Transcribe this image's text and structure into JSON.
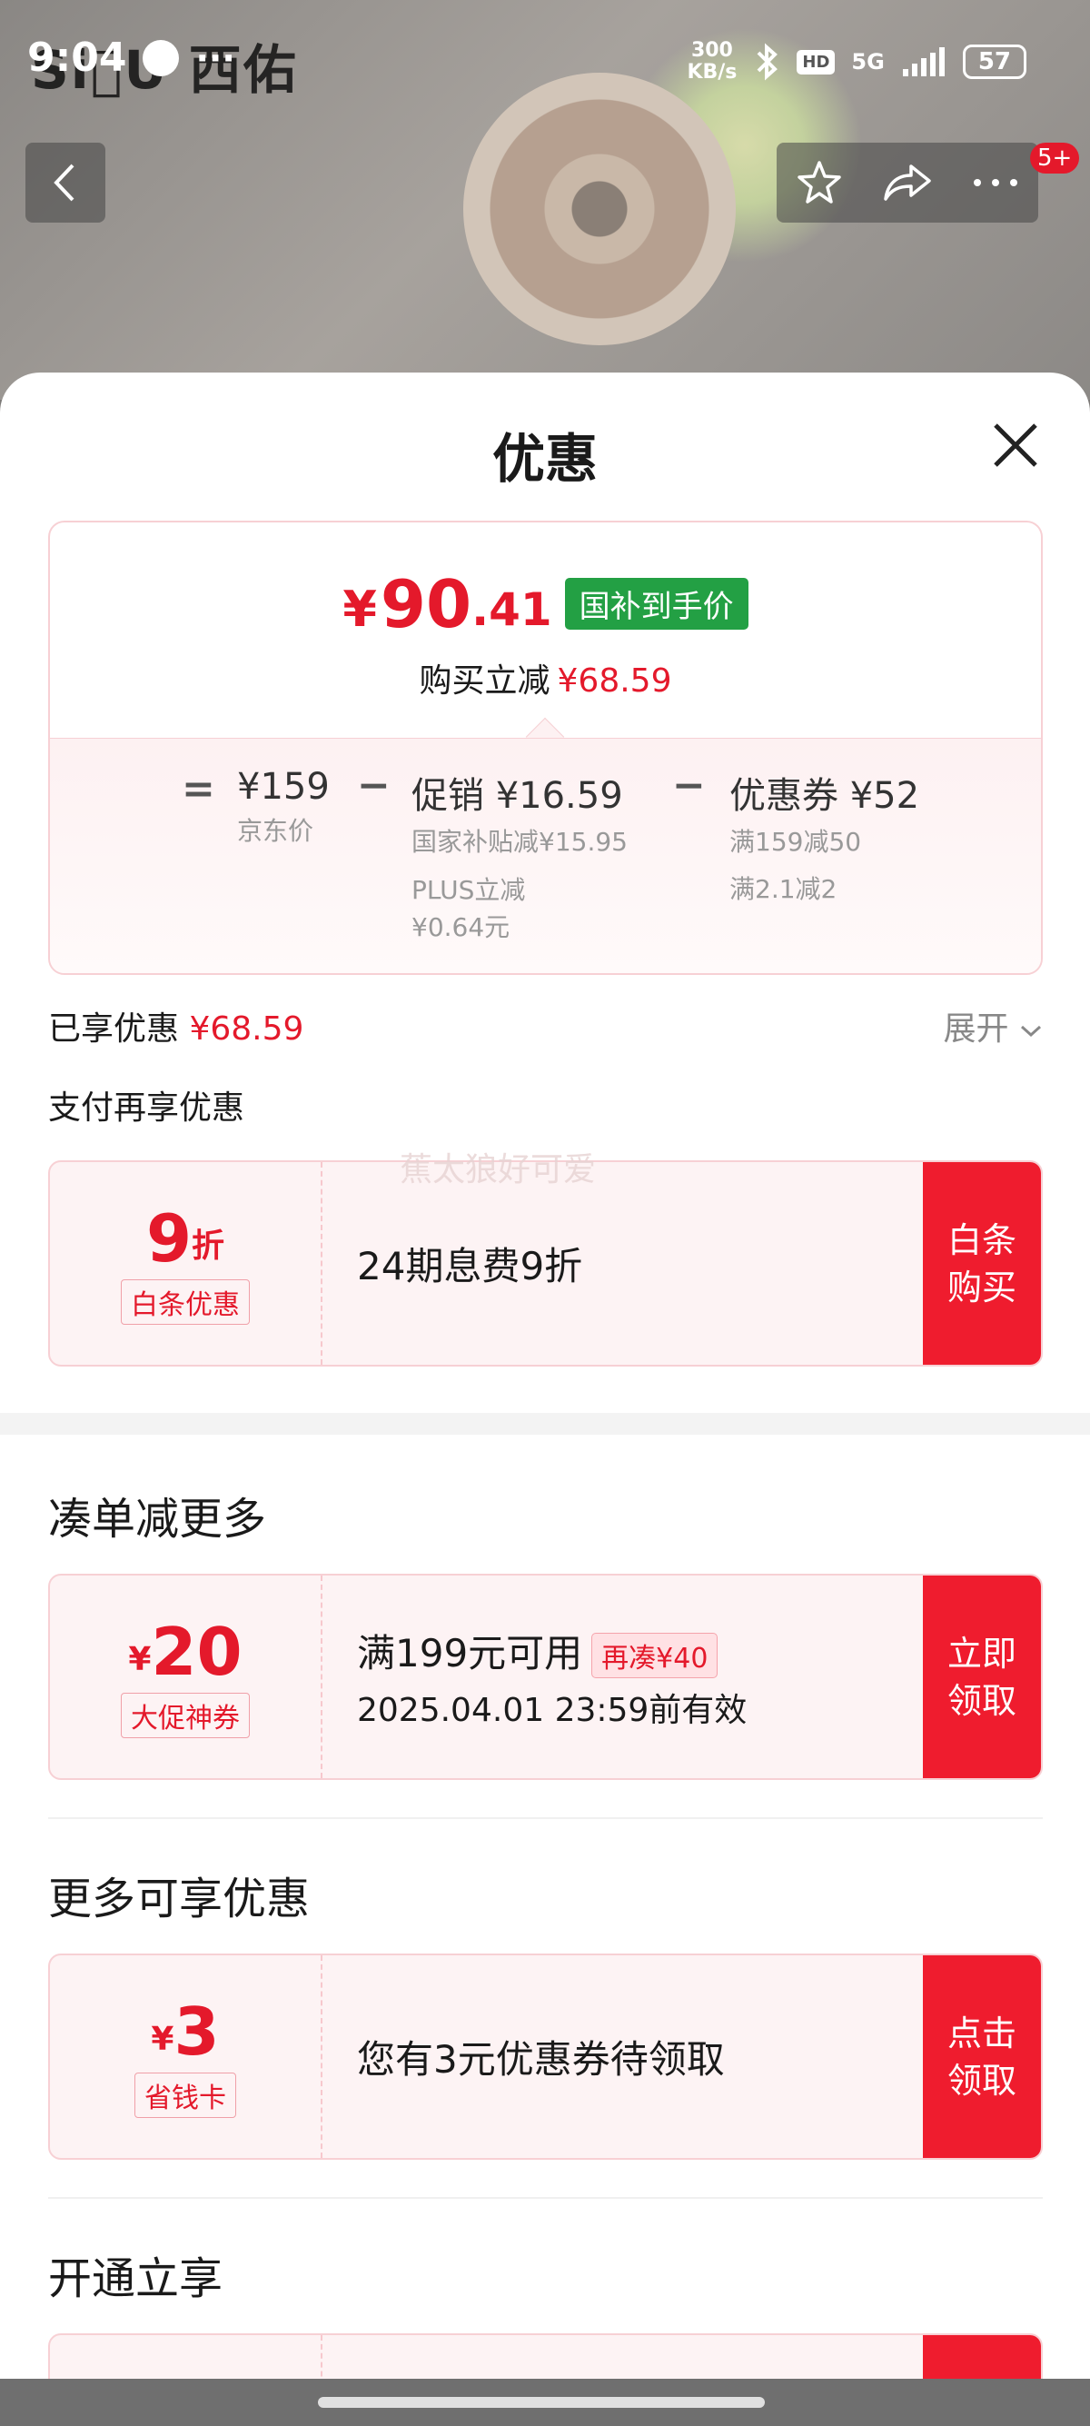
{
  "status_bar": {
    "time": "9:04",
    "brand_overlay": "Si\u0000U 西佑",
    "dots": "···",
    "net_speed_top": "300",
    "net_speed_bottom": "KB/s",
    "hd": "HD",
    "signal": "5G",
    "battery": "57"
  },
  "nav": {
    "badge": "5+"
  },
  "sheet": {
    "title": "优惠",
    "summary": {
      "currency": "¥",
      "price_int": "90",
      "price_dec": ".41",
      "price_tag": "国补到手价",
      "save_label": "购买立减",
      "save_amount": "¥68.59",
      "breakdown": {
        "eq": "=",
        "minus": "−",
        "jd_amount": "¥159",
        "jd_label": "京东价",
        "promo_amount": "促销 ¥16.59",
        "promo_sub1": "国家补贴减¥15.95",
        "promo_sub2": "PLUS立减",
        "promo_sub3": "¥0.64元",
        "coupon_amount": "优惠券 ¥52",
        "coupon_sub1": "满159减50",
        "coupon_sub2": "满2.1减2"
      }
    },
    "applied_label": "已享优惠",
    "applied_amount": "¥68.59",
    "expand_label": "展开",
    "pay_more_label": "支付再享优惠",
    "watermark": "蕉太狼好可爱",
    "baitiao": {
      "amount": "9",
      "unit": "折",
      "name": "白条优惠",
      "desc": "24期息费9折",
      "button_line1": "白条",
      "button_line2": "购买"
    },
    "section_more_reduce": "凑单减更多",
    "promo_coupon": {
      "currency": "¥",
      "amount": "20",
      "name": "大促神券",
      "condition": "满199元可用",
      "tag": "再凑¥40",
      "expiry": "2025.04.01 23:59前有效",
      "button_line1": "立即",
      "button_line2": "领取"
    },
    "section_more_offers": "更多可享优惠",
    "saving_card": {
      "currency": "¥",
      "amount": "3",
      "name": "省钱卡",
      "desc": "您有3元优惠券待领取",
      "button_line1": "点击",
      "button_line2": "领取"
    },
    "section_open": "开通立享"
  }
}
